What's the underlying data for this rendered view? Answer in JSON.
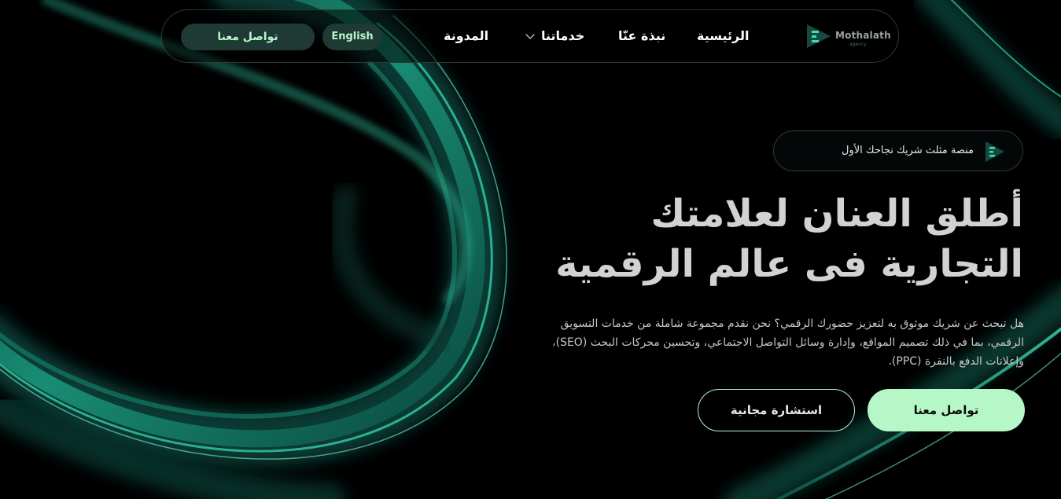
{
  "brand": {
    "logo_text": "Mothalath",
    "logo_sub": "agency"
  },
  "nav": {
    "home": "الرئيسية",
    "about": "نبذة عنّا",
    "services": "خدماتنا",
    "blog": "المدونة",
    "language": "English",
    "contact": "تواصل معنا"
  },
  "hero": {
    "badge": "منصة مثلث شريك نجاحك الأول",
    "headline_line1": "أطلق العنان لعلامتك",
    "headline_line2": "التجارية فى عالم الرقمية",
    "description": "هل تبحث عن شريك موثوق به لتعزيز حضورك الرقمي؟ نحن نقدم مجموعة شاملة من خدمات التسويق الرقمي، بما في ذلك تصميم المواقع، وإدارة وسائل التواصل الاجتماعي، وتحسين محركات البحث (SEO)، وإعلانات الدفع بالنقرة (PPC).",
    "primary_button": "تواصل معنا",
    "secondary_button": "استشارة مجانية"
  },
  "colors": {
    "accent": "#b6f7c8",
    "teal": "#1fb08f",
    "background": "#000000"
  },
  "icons": {
    "logo": "triangle-logo-icon",
    "dropdown": "chevron-down-icon"
  }
}
